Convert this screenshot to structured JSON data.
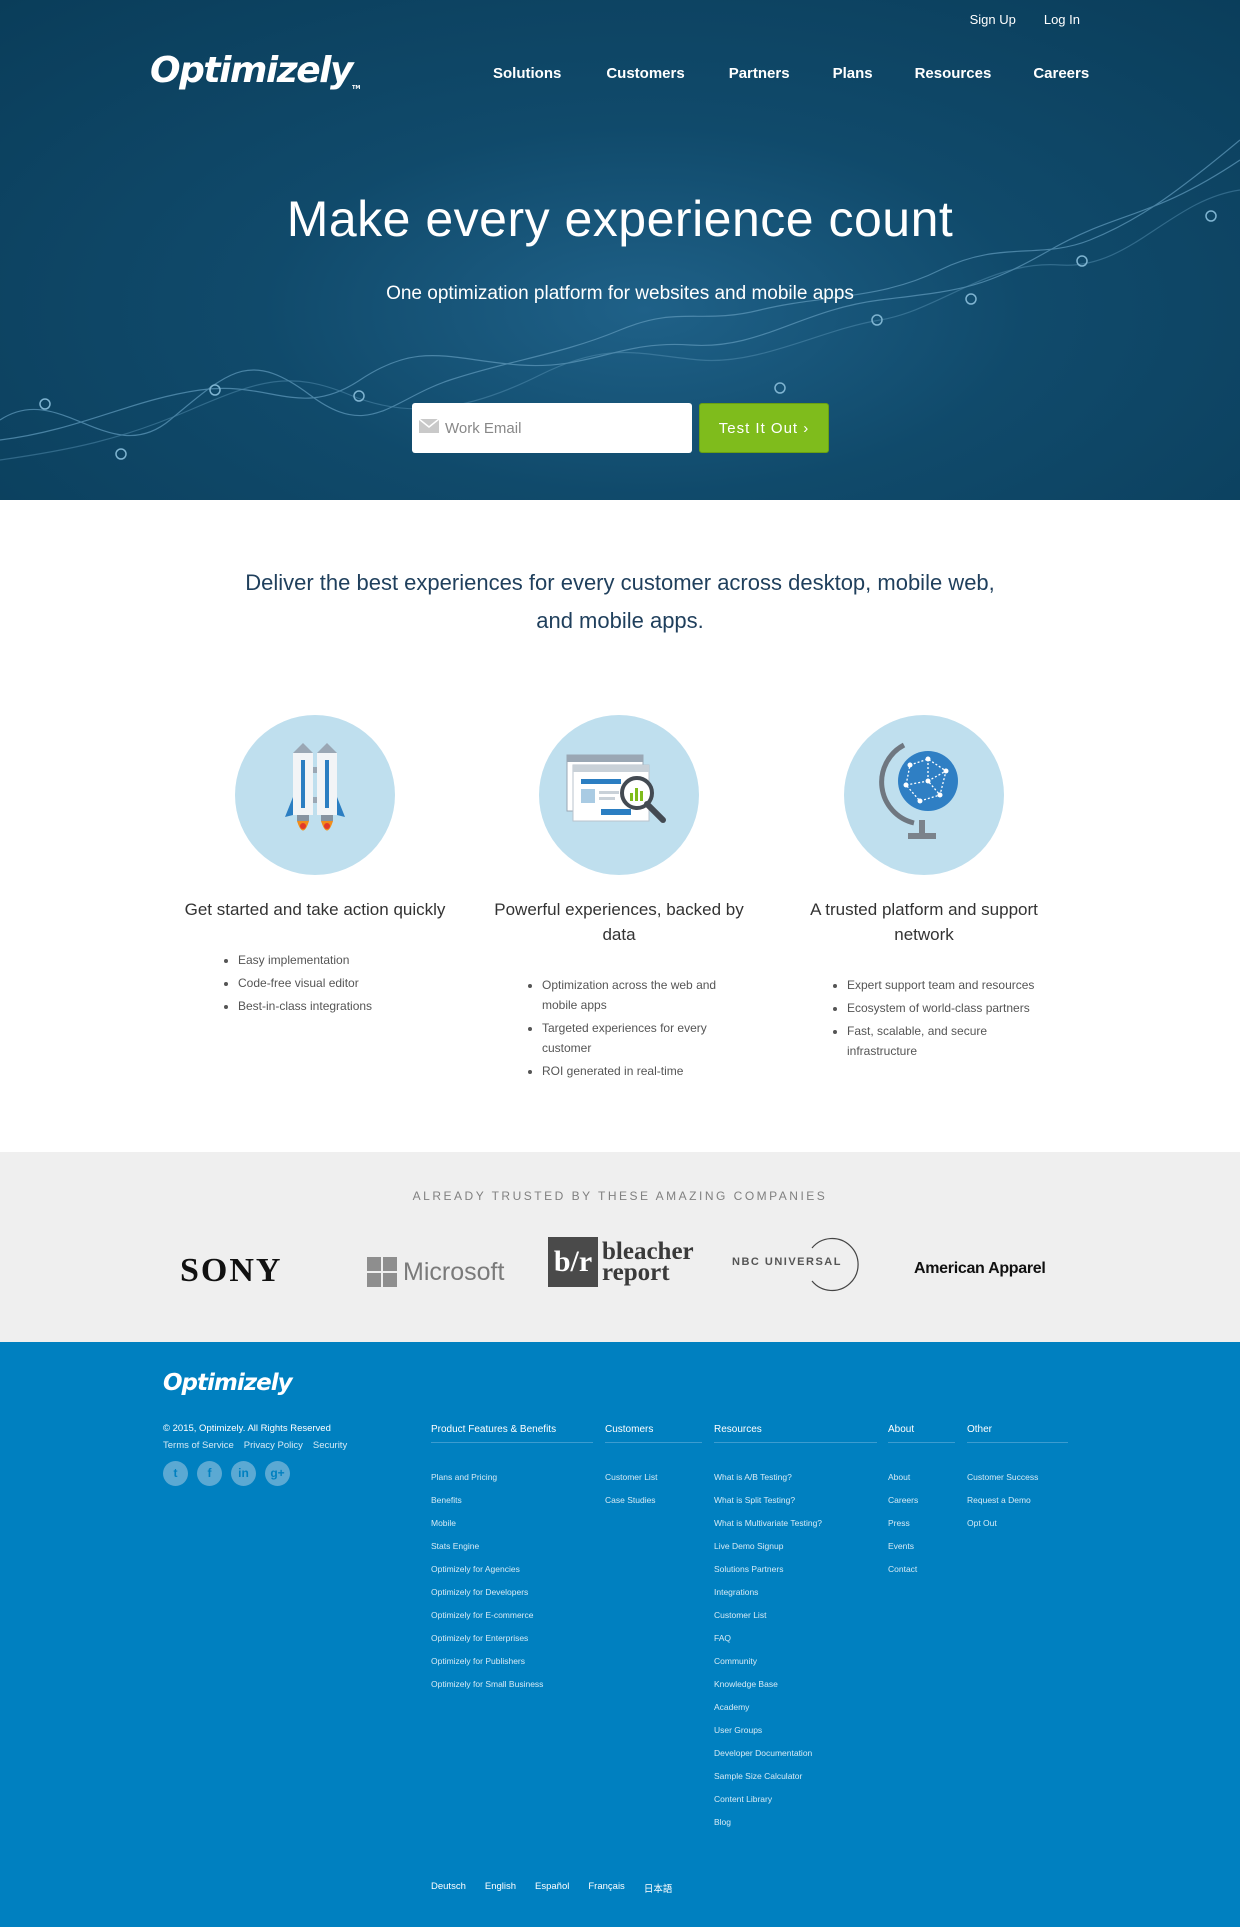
{
  "topbar": {
    "signup": "Sign Up",
    "login": "Log In"
  },
  "brand": {
    "name": "Optimizely",
    "tm": "TM"
  },
  "nav": [
    "Solutions",
    "Customers",
    "Partners",
    "Plans",
    "Resources",
    "Careers"
  ],
  "hero": {
    "headline": "Make every experience count",
    "subheadline": "One optimization platform for websites and mobile apps",
    "email_placeholder": "Work Email",
    "cta": "Test It Out ›"
  },
  "intro": "Deliver the best experiences for every customer across desktop, mobile web, and mobile apps.",
  "features": [
    {
      "icon": "rocket-icon",
      "title": "Get started and take action quickly",
      "bullets": [
        "Easy implementation",
        "Code-free visual editor",
        "Best-in-class integrations"
      ]
    },
    {
      "icon": "analytics-magnifier-icon",
      "title": "Powerful experiences, backed by data",
      "bullets": [
        "Optimization across the web and mobile apps",
        "Targeted experiences for every customer",
        "ROI generated in real-time"
      ]
    },
    {
      "icon": "globe-icon",
      "title": "A trusted platform and support network",
      "bullets": [
        "Expert support team and resources",
        "Ecosystem of world-class partners",
        "Fast, scalable, and secure infrastructure"
      ]
    }
  ],
  "trusted": {
    "label": "ALREADY TRUSTED BY THESE AMAZING COMPANIES",
    "logos": {
      "sony": "SONY",
      "microsoft": "Microsoft",
      "bleacher_box": "b/r",
      "bleacher_line1": "bleacher",
      "bleacher_line2": "report",
      "nbc": "NBC UNIVERSAL",
      "american_apparel": "American Apparel"
    }
  },
  "footer": {
    "brand": "Optimizely",
    "copyright": "© 2015, Optimizely. All Rights Reserved",
    "links": [
      "Terms of Service",
      "Privacy Policy",
      "Security"
    ],
    "socials": [
      {
        "icon": "twitter-icon",
        "glyph": "t"
      },
      {
        "icon": "facebook-icon",
        "glyph": "f"
      },
      {
        "icon": "linkedin-icon",
        "glyph": "in"
      },
      {
        "icon": "google-plus-icon",
        "glyph": "g+"
      }
    ],
    "columns": [
      {
        "title": "Product Features & Benefits",
        "items": [
          "Plans and Pricing",
          "Benefits",
          "Mobile",
          "Stats Engine",
          "Optimizely for Agencies",
          "Optimizely for Developers",
          "Optimizely for E-commerce",
          "Optimizely for Enterprises",
          "Optimizely for Publishers",
          "Optimizely for Small Business"
        ]
      },
      {
        "title": "Customers",
        "items": [
          "Customer List",
          "Case Studies"
        ]
      },
      {
        "title": "Resources",
        "items": [
          "What is A/B Testing?",
          "What is Split Testing?",
          "What is Multivariate Testing?",
          "Live Demo Signup",
          "Solutions Partners",
          "Integrations",
          "Customer List",
          "FAQ",
          "Community",
          "Knowledge Base",
          "Academy",
          "User Groups",
          "Developer Documentation",
          "Sample Size Calculator",
          "Content Library",
          "Blog"
        ]
      },
      {
        "title": "About",
        "items": [
          "About",
          "Careers",
          "Press",
          "Events",
          "Contact"
        ]
      },
      {
        "title": "Other",
        "items": [
          "Customer Success",
          "Request a Demo",
          "Opt Out"
        ]
      }
    ],
    "languages": [
      "Deutsch",
      "English",
      "Español",
      "Français",
      "日本語"
    ]
  },
  "colors": {
    "hero_bg": "#0d4563",
    "cta_green": "#7fbc1c",
    "footer_blue": "#0080c0",
    "trusted_bg": "#efefef",
    "feature_circle": "#bfdfee"
  }
}
